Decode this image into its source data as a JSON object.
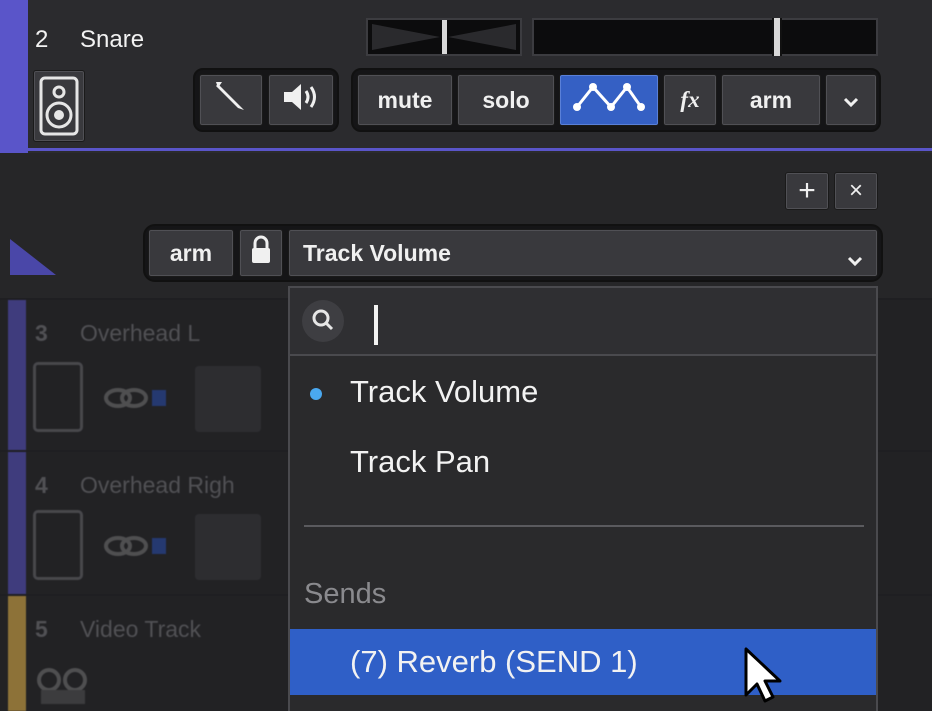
{
  "snare_track": {
    "number": "2",
    "name": "Snare",
    "buttons": {
      "mute": "mute",
      "solo": "solo",
      "fx": "fx",
      "arm": "arm"
    },
    "color": "#5a55c9"
  },
  "automation_lane": {
    "arm_label": "arm",
    "parameter_selected": "Track Volume",
    "add_symbol": "+",
    "close_symbol": "×"
  },
  "other_tracks": [
    {
      "number": "3",
      "name": "Overhead L",
      "color": "#5a55c9"
    },
    {
      "number": "4",
      "name": "Overhead Righ",
      "color": "#5a55c9"
    },
    {
      "number": "5",
      "name": "Video Track",
      "color": "#e8b74a"
    }
  ],
  "dropdown": {
    "search_value": "",
    "items": [
      {
        "label": "Track Volume",
        "selected": true
      },
      {
        "label": "Track Pan",
        "selected": false
      }
    ],
    "section_header": "Sends",
    "highlighted_item": "(7) Reverb (SEND 1)",
    "highlight_color": "#2f5fc7",
    "selected_dot_color": "#4aa8f0"
  }
}
